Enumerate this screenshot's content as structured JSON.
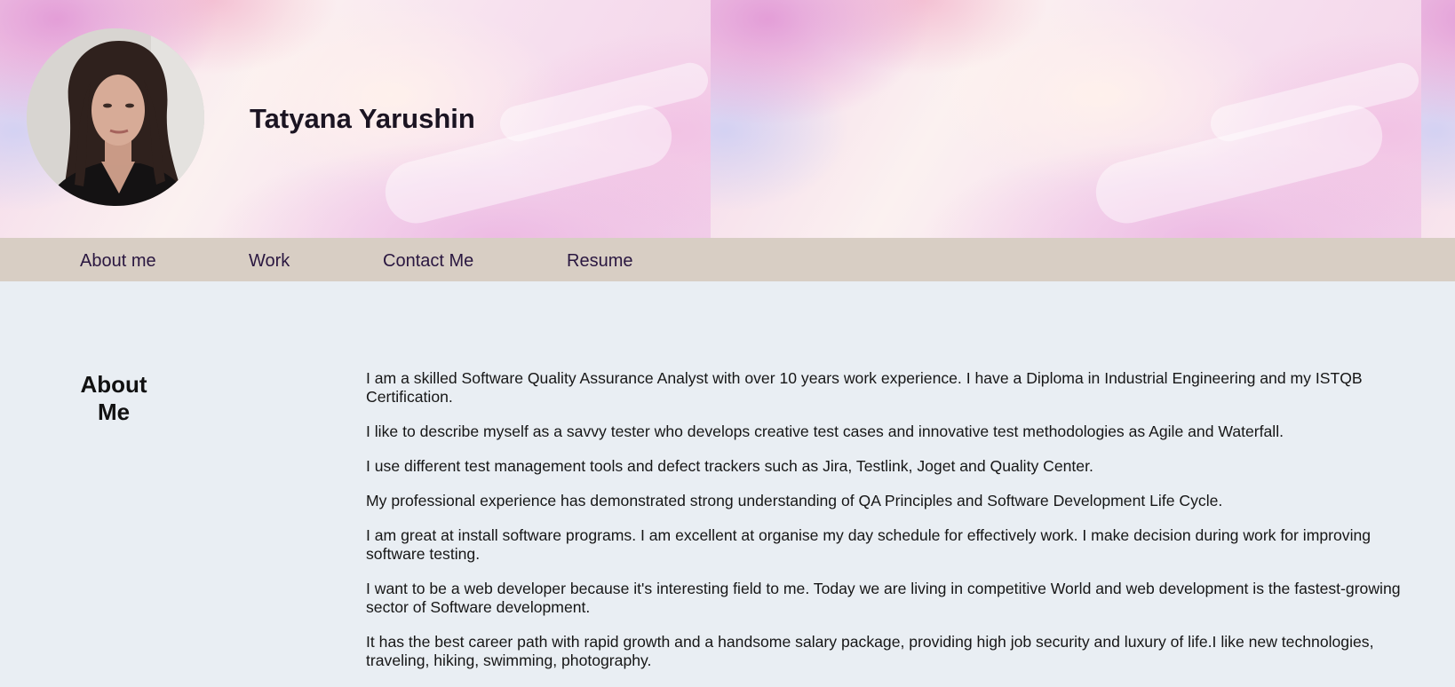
{
  "header": {
    "name": "Tatyana Yarushin",
    "avatar_icon": "profile-photo"
  },
  "nav": {
    "items": [
      {
        "label": "About me"
      },
      {
        "label": "Work"
      },
      {
        "label": "Contact Me"
      },
      {
        "label": "Resume"
      }
    ]
  },
  "about": {
    "heading": "About Me",
    "paragraphs": [
      "I am a skilled Software Quality Assurance Analyst with over 10 years work experience. I have a Diploma in Industrial Engineering and my ISTQB Certification.",
      "I like to describe myself as a savvy tester who develops creative test cases and innovative test methodologies as Agile and Waterfall.",
      "I use different test management tools and defect trackers such as Jira, Testlink, Joget and Quality Center.",
      "My professional experience has demonstrated strong understanding of QA Principles and Software Development Life Cycle.",
      "I am great at install software programs. I am excellent at organise my day schedule for effectively work. I make decision during work for improving software testing.",
      "I want to be a web developer because it's interesting field to me. Today we are living in competitive World and web development is the fastest-growing sector of Software development.",
      "It has the best career path with rapid growth and a handsome salary package, providing high job security and luxury of life.I like new technologies, traveling, hiking, swimming, photography."
    ]
  },
  "colors": {
    "page_background": "#e9eef3",
    "nav_background": "#d8cec4",
    "nav_text": "#2a1740",
    "title_text": "#1b1422"
  }
}
